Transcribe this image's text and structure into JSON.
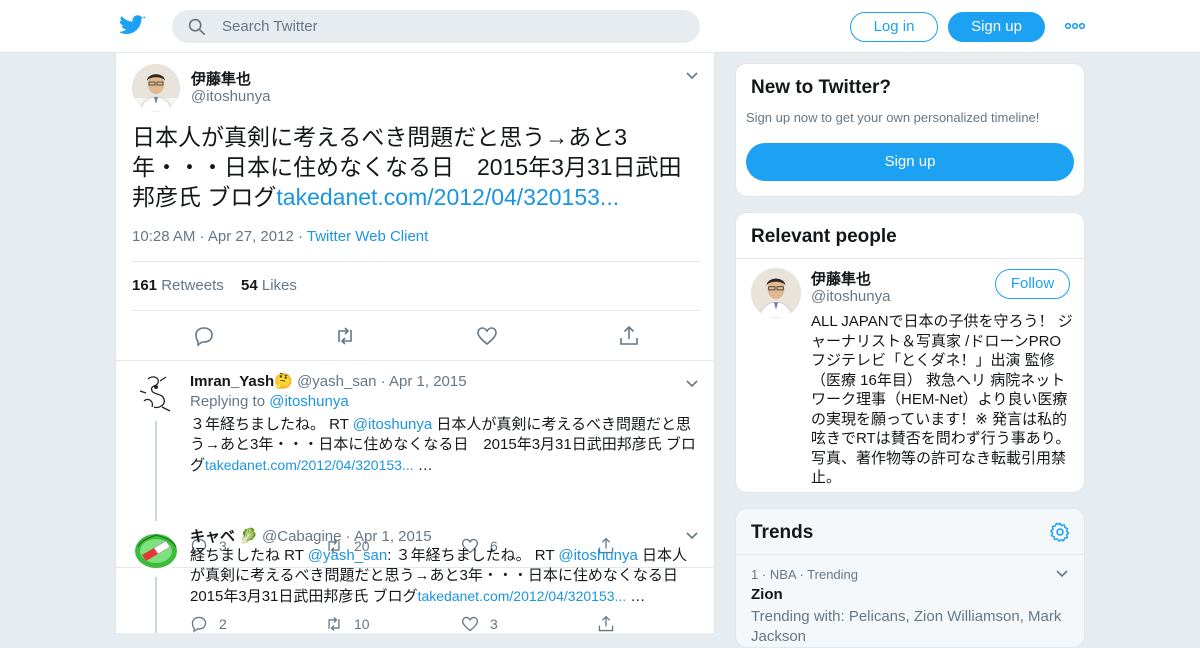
{
  "header": {
    "search_placeholder": "Search Twitter",
    "login_label": "Log in",
    "signup_label": "Sign up",
    "more_label": "•••"
  },
  "tweet": {
    "author_name": "伊藤隼也",
    "author_handle": "@itoshunya",
    "text": "日本人が真剣に考えるべき問題だと思う→あと3年・・・日本に住めなくなる日　2015年3月31日武田邦彦氏 ブログ",
    "link": "takedanet.com/2012/04/320153...",
    "time": "10:28 AM",
    "date": "Apr 27, 2012",
    "source": "Twitter Web Client",
    "retweets": "161",
    "retweets_label": "Retweets",
    "likes": "54",
    "likes_label": "Likes"
  },
  "replies": [
    {
      "name": "Imran_Yash🤔",
      "handle": "@yash_san",
      "date": "Apr 1, 2015",
      "replying_label": "Replying to",
      "replying_to": "@itoshunya",
      "text_prefix": "３年経ちましたね。 RT ",
      "text_mention": "@itoshunya",
      "text_body": " 日本人が真剣に考えるべき問題だと思う→あと3年・・・日本に住めなくなる日　2015年3月31日武田邦彦氏 ブログ",
      "link": "takedanet.com/2012/04/320153...",
      "ellipsis": " …",
      "reply_count": "3",
      "retweet_count": "20",
      "like_count": "6"
    },
    {
      "name": "キャベ 🥬",
      "handle": "@Cabagine",
      "date": "Apr 1, 2015",
      "text_a": "経ちましたね RT ",
      "mention_a": "@yash_san",
      "text_b": ": ３年経ちましたね。 RT ",
      "mention_b": "@itoshunya",
      "text_c": " 日本人が真剣に考えるべき問題だと思う→あと3年・・・日本に住めなくなる日　2015年3月31日武田邦彦氏 ブログ",
      "link": "takedanet.com/2012/04/320153...",
      "ellipsis": " …",
      "reply_count": "2",
      "retweet_count": "10",
      "like_count": "3"
    }
  ],
  "sidebar": {
    "new_title": "New to Twitter?",
    "new_sub": "Sign up now to get your own personalized timeline!",
    "new_button": "Sign up",
    "relevant_title": "Relevant people",
    "person_name": "伊藤隼也",
    "person_handle": "@itoshunya",
    "follow_label": "Follow",
    "person_bio": "ALL JAPANで日本の子供を守ろう！ ジャーナリスト＆写真家 /ドローンPRO フジテレビ「とくダネ！」出演 監修（医療 16年目） 救急ヘリ 病院ネットワーク理事（HEM-Net）より良い医療の実現を願っています！※ 発言は私的呟きでRTは賛否を問わず行う事あり。写真、著作物等の許可なき転載引用禁止。",
    "trends_title": "Trends",
    "trend_rank": "1",
    "trend_category": "NBA",
    "trend_status": "Trending",
    "trend_name": "Zion",
    "trend_with": "Trending with: Pelicans, Zion Williamson, Mark Jackson"
  },
  "colors": {
    "accent": "#1da1f2",
    "link": "#1b95e0",
    "muted": "#657786",
    "background": "#e6ecf0"
  }
}
